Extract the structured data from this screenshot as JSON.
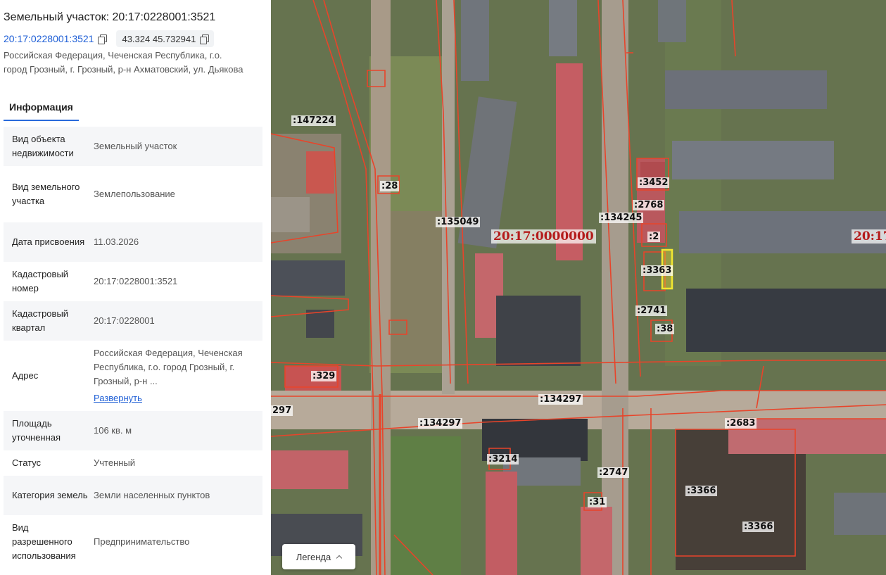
{
  "title": "Земельный участок: 20:17:0228001:3521",
  "cadastral_link": "20:17:0228001:3521",
  "coordinates": "43.324 45.732941",
  "address": "Российская Федерация, Чеченская Республика, г.о. город Грозный, г. Грозный, р-н Ахматовский, ул. Дьякова",
  "tabs": [
    {
      "label": "Информация"
    }
  ],
  "info": {
    "rows": [
      {
        "label": "Вид объекта недвижимости",
        "value": "Земельный участок"
      },
      {
        "label": "Вид земельного участка",
        "value": "Землепользование"
      },
      {
        "label": "Дата присвоения",
        "value": "11.03.2026"
      },
      {
        "label": "Кадастровый номер",
        "value": "20:17:0228001:3521"
      },
      {
        "label": "Кадастровый квартал",
        "value": "20:17:0228001"
      },
      {
        "label": "Адрес",
        "value": "Российская Федерация, Чеченская Республика, г.о. город Грозный, г. Грозный, р-н ...",
        "link": "Развернуть"
      },
      {
        "label": "Площадь уточненная",
        "value": "106 кв. м"
      },
      {
        "label": "Статус",
        "value": "Учтенный"
      },
      {
        "label": "Категория земель",
        "value": "Земли населенных пунктов"
      },
      {
        "label": "Вид разрешенного использования",
        "value": "Предпринимательство"
      }
    ]
  },
  "map": {
    "quarter_label": "20:17:0000000",
    "quarter_label_right": "20:17",
    "parcel_labels": [
      ":147224",
      ":28",
      ":135049",
      ":134245",
      ":3452",
      ":2768",
      ":2",
      ":3363",
      ":2741",
      ":38",
      ":329",
      "297",
      ":134297",
      ":134297",
      ":2683",
      ":3214",
      ":2747",
      ":31",
      ":3366",
      ":3366"
    ],
    "legend_label": "Легенда",
    "accent_color": "#e8442a",
    "selected_color": "#f2e630"
  }
}
